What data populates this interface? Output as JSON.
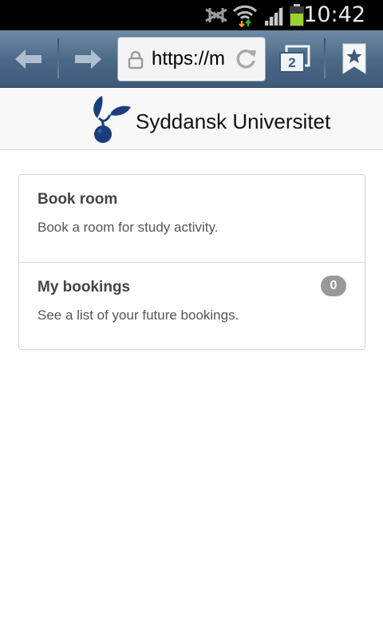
{
  "status_bar": {
    "time": "10:42",
    "icons": [
      "nfc-muted-icon",
      "wifi-icon",
      "signal-icon",
      "battery-icon"
    ],
    "battery_color": "#9bd32a"
  },
  "browser": {
    "url": "https://m",
    "tab_count": "2",
    "icons": [
      "back-arrow-icon",
      "forward-arrow-icon",
      "lock-icon",
      "refresh-icon",
      "tabs-icon",
      "bookmark-star-icon"
    ]
  },
  "header": {
    "site_name": "Syddansk Universitet",
    "logo_icon": "sdu-apple-branch-logo",
    "logo_color": "#1b3d7e"
  },
  "menu": {
    "items": [
      {
        "title": "Book room",
        "description": "Book a room for study activity."
      },
      {
        "title": "My bookings",
        "description": "See a list of your future bookings.",
        "badge": "0"
      }
    ]
  }
}
